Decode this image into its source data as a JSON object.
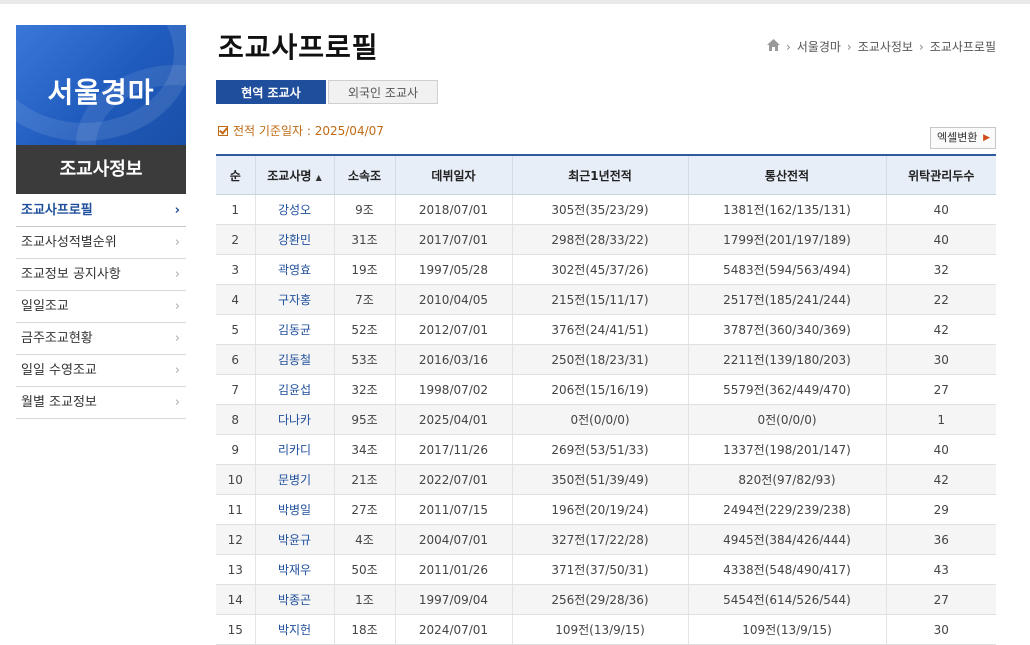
{
  "sidebar": {
    "banner_title": "서울경마",
    "sub_title": "조교사정보",
    "items": [
      {
        "label": "조교사프로필",
        "active": true
      },
      {
        "label": "조교사성적별순위",
        "active": false
      },
      {
        "label": "조교정보 공지사항",
        "active": false
      },
      {
        "label": "일일조교",
        "active": false
      },
      {
        "label": "금주조교현황",
        "active": false
      },
      {
        "label": "일일 수영조교",
        "active": false
      },
      {
        "label": "월별 조교정보",
        "active": false
      }
    ]
  },
  "header": {
    "title": "조교사프로필",
    "breadcrumb": [
      "서울경마",
      "조교사정보",
      "조교사프로필"
    ]
  },
  "tabs": [
    {
      "label": "현역 조교사",
      "active": true
    },
    {
      "label": "외국인 조교사",
      "active": false
    }
  ],
  "ref_date": "전적 기준일자 : 2025/04/07",
  "excel_button": "엑셀변환",
  "table": {
    "headers": [
      "순",
      "조교사명",
      "소속조",
      "데뷔일자",
      "최근1년전적",
      "통산전적",
      "위탁관리두수"
    ],
    "sort_indicator": "▲",
    "rows": [
      [
        "1",
        "강성오",
        "9조",
        "2018/07/01",
        "305전(35/23/29)",
        "1381전(162/135/131)",
        "40"
      ],
      [
        "2",
        "강환민",
        "31조",
        "2017/07/01",
        "298전(28/33/22)",
        "1799전(201/197/189)",
        "40"
      ],
      [
        "3",
        "곽영효",
        "19조",
        "1997/05/28",
        "302전(45/37/26)",
        "5483전(594/563/494)",
        "32"
      ],
      [
        "4",
        "구자홍",
        "7조",
        "2010/04/05",
        "215전(15/11/17)",
        "2517전(185/241/244)",
        "22"
      ],
      [
        "5",
        "김동균",
        "52조",
        "2012/07/01",
        "376전(24/41/51)",
        "3787전(360/340/369)",
        "42"
      ],
      [
        "6",
        "김동철",
        "53조",
        "2016/03/16",
        "250전(18/23/31)",
        "2211전(139/180/203)",
        "30"
      ],
      [
        "7",
        "김윤섭",
        "32조",
        "1998/07/02",
        "206전(15/16/19)",
        "5579전(362/449/470)",
        "27"
      ],
      [
        "8",
        "다나카",
        "95조",
        "2025/04/01",
        "0전(0/0/0)",
        "0전(0/0/0)",
        "1"
      ],
      [
        "9",
        "리카디",
        "34조",
        "2017/11/26",
        "269전(53/51/33)",
        "1337전(198/201/147)",
        "40"
      ],
      [
        "10",
        "문병기",
        "21조",
        "2022/07/01",
        "350전(51/39/49)",
        "820전(97/82/93)",
        "42"
      ],
      [
        "11",
        "박병일",
        "27조",
        "2011/07/15",
        "196전(20/19/24)",
        "2494전(229/239/238)",
        "29"
      ],
      [
        "12",
        "박윤규",
        "4조",
        "2004/07/01",
        "327전(17/22/28)",
        "4945전(384/426/444)",
        "36"
      ],
      [
        "13",
        "박재우",
        "50조",
        "2011/01/26",
        "371전(37/50/31)",
        "4338전(548/490/417)",
        "43"
      ],
      [
        "14",
        "박종곤",
        "1조",
        "1997/09/04",
        "256전(29/28/36)",
        "5454전(614/526/544)",
        "27"
      ],
      [
        "15",
        "박지헌",
        "18조",
        "2024/07/01",
        "109전(13/9/15)",
        "109전(13/9/15)",
        "30"
      ]
    ]
  },
  "colors": {
    "accent": "#1f4f9c",
    "date_text": "#c06a13",
    "header_bg": "#e7eef7"
  }
}
